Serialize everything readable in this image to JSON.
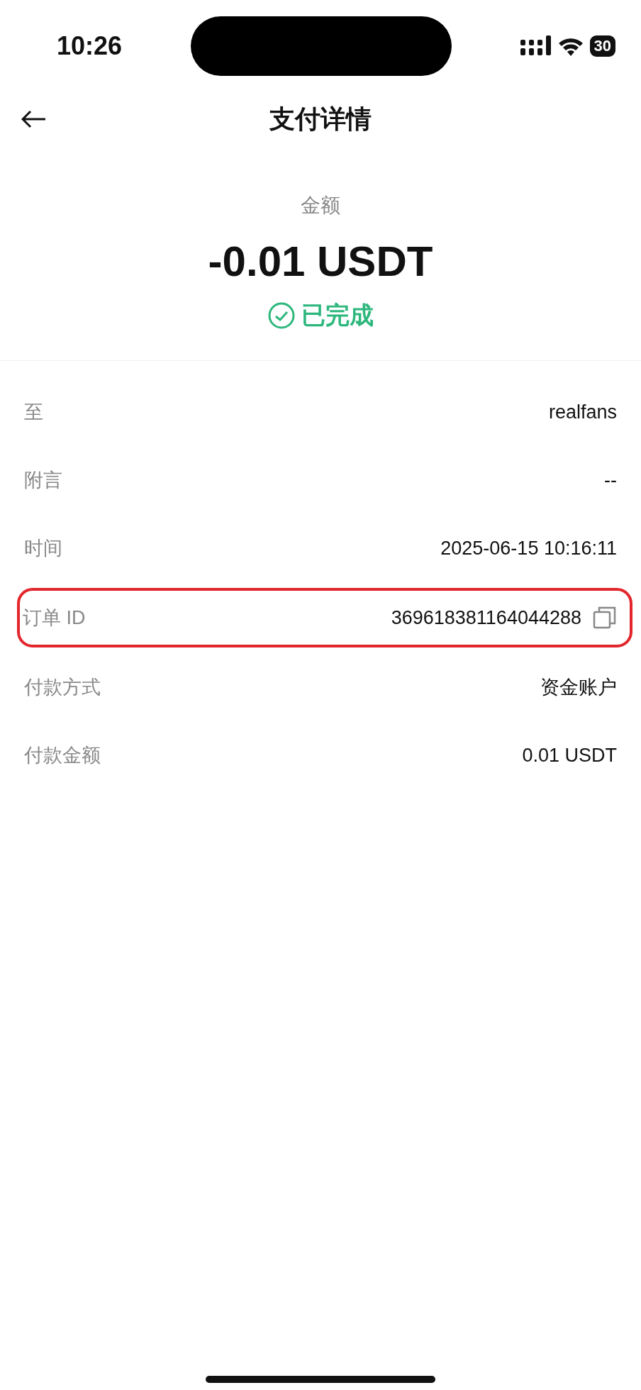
{
  "status_bar": {
    "time": "10:26",
    "battery": "30"
  },
  "header": {
    "title": "支付详情"
  },
  "summary": {
    "label": "金额",
    "amount": "-0.01 USDT",
    "status": "已完成"
  },
  "details": [
    {
      "label": "至",
      "value": "realfans",
      "copyable": false,
      "highlighted": false
    },
    {
      "label": "附言",
      "value": "--",
      "copyable": false,
      "highlighted": false
    },
    {
      "label": "时间",
      "value": "2025-06-15 10:16:11",
      "copyable": false,
      "highlighted": false
    },
    {
      "label": "订单 ID",
      "value": "369618381164044288",
      "copyable": true,
      "highlighted": true
    },
    {
      "label": "付款方式",
      "value": "资金账户",
      "copyable": false,
      "highlighted": false
    },
    {
      "label": "付款金额",
      "value": "0.01 USDT",
      "copyable": false,
      "highlighted": false
    }
  ]
}
